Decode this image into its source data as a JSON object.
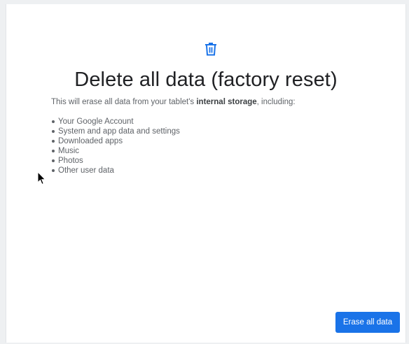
{
  "dialog": {
    "icon": "trash-icon",
    "title": "Delete all data (factory reset)",
    "description": {
      "prefix": "This will erase all data from your tablet's ",
      "emphasis": "internal storage",
      "suffix": ", including:"
    },
    "items": [
      "Your Google Account",
      "System and app data and settings",
      "Downloaded apps",
      "Music",
      "Photos",
      "Other user data"
    ],
    "erase_button_label": "Erase all data"
  },
  "colors": {
    "accent": "#1a73e8",
    "title": "#202124",
    "body_text": "#5f6368"
  }
}
